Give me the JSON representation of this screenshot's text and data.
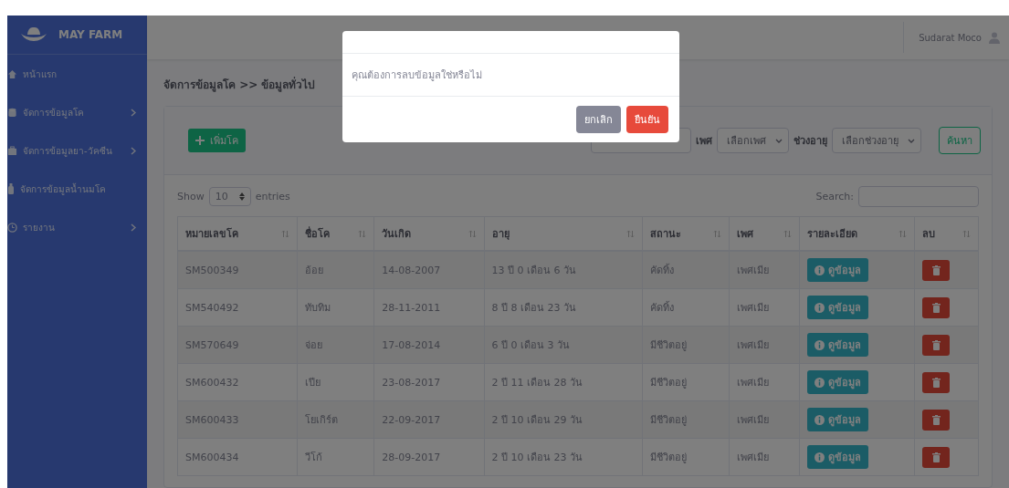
{
  "brand": {
    "name": "MAY FARM"
  },
  "sidebar": {
    "items": [
      {
        "label": "หน้าแรก",
        "kind": "home",
        "expandable": false
      },
      {
        "label": "จัดการข้อมูลโค",
        "kind": "database",
        "expandable": true
      },
      {
        "label": "จัดการข้อมูลยา-วัคซีน",
        "kind": "kit",
        "expandable": true
      },
      {
        "label": "จัดการข้อมูลน้ำนมโค",
        "kind": "bottle",
        "expandable": false
      },
      {
        "label": "รายงาน",
        "kind": "clock",
        "expandable": true
      }
    ]
  },
  "topbar": {
    "user": "Sudarat Moco"
  },
  "breadcrumb": "จัดการข้อมูลโค >> ข้อมูลทั่วไป",
  "toolbar": {
    "add_button": "เพิ่มโค",
    "filters": [
      {
        "label": "เพศ",
        "placeholder": "เลือกเพศ"
      },
      {
        "label": "ช่วงอายุ",
        "placeholder": "เลือกช่วงอายุ"
      }
    ],
    "search_button": "ค้นหา"
  },
  "table_controls": {
    "show_label": "Show",
    "page_size": "10",
    "entries_label": "entries",
    "search_label": "Search:"
  },
  "table": {
    "columns": [
      "หมายเลขโค",
      "ชื่อโค",
      "วันเกิด",
      "อายุ",
      "สถานะ",
      "เพศ",
      "รายละเอียด",
      "ลบ"
    ],
    "rows": [
      {
        "id": "SM500349",
        "name": "อ้อย",
        "birth": "14-08-2007",
        "age": "13 ปี 0 เดือน 6 วัน",
        "status": "คัดทิ้ง",
        "sex": "เพศเมีย",
        "detail": "ดูข้อมูล"
      },
      {
        "id": "SM540492",
        "name": "ทับทิม",
        "birth": "28-11-2011",
        "age": "8 ปี 8 เดือน 23 วัน",
        "status": "คัดทิ้ง",
        "sex": "เพศเมีย",
        "detail": "ดูข้อมูล"
      },
      {
        "id": "SM570649",
        "name": "จ่อย",
        "birth": "17-08-2014",
        "age": "6 ปี 0 เดือน 3 วัน",
        "status": "มีชีวิตอยู่",
        "sex": "เพศเมีย",
        "detail": "ดูข้อมูล"
      },
      {
        "id": "SM600432",
        "name": "เปีย",
        "birth": "23-08-2017",
        "age": "2 ปี 11 เดือน 28 วัน",
        "status": "มีชีวิตอยู่",
        "sex": "เพศเมีย",
        "detail": "ดูข้อมูล"
      },
      {
        "id": "SM600433",
        "name": "โยเกิร์ต",
        "birth": "22-09-2017",
        "age": "2 ปี 10 เดือน 29 วัน",
        "status": "มีชีวิตอยู่",
        "sex": "เพศเมีย",
        "detail": "ดูข้อมูล"
      },
      {
        "id": "SM600434",
        "name": "วีโก้",
        "birth": "28-09-2017",
        "age": "2 ปี 10 เดือน 23 วัน",
        "status": "มีชีวิตอยู่",
        "sex": "เพศเมีย",
        "detail": "ดูข้อมูล"
      }
    ]
  },
  "dialog": {
    "message": "คุณต้องการลบข้อมูลใช่หรือไม่",
    "cancel": "ยกเลิก",
    "confirm": "ยืนยัน"
  }
}
